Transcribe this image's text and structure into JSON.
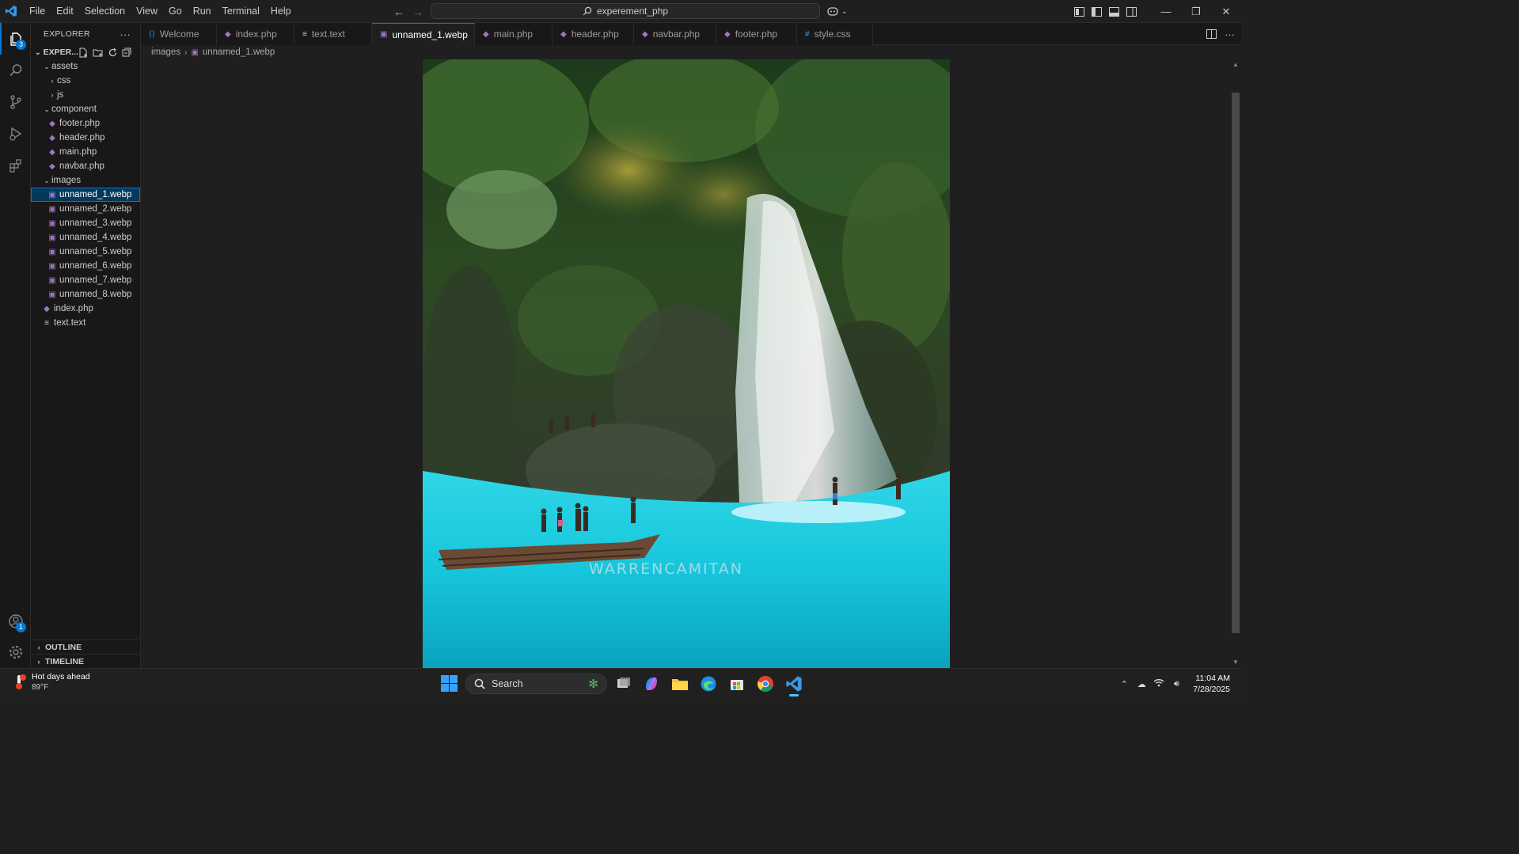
{
  "titlebar": {
    "menu": [
      "File",
      "Edit",
      "Selection",
      "View",
      "Go",
      "Run",
      "Terminal",
      "Help"
    ],
    "search_text": "experement_php"
  },
  "activity": {
    "explorer_badge": "3",
    "accounts_badge": "1"
  },
  "sidebar": {
    "title": "EXPLORER",
    "root_label": "EXPER...",
    "tree": [
      {
        "label": "assets",
        "kind": "folder-open",
        "depth": 1
      },
      {
        "label": "css",
        "kind": "folder",
        "depth": 2
      },
      {
        "label": "js",
        "kind": "folder",
        "depth": 2
      },
      {
        "label": "component",
        "kind": "folder-open",
        "depth": 1
      },
      {
        "label": "footer.php",
        "kind": "php",
        "depth": 2
      },
      {
        "label": "header.php",
        "kind": "php",
        "depth": 2
      },
      {
        "label": "main.php",
        "kind": "php",
        "depth": 2
      },
      {
        "label": "navbar.php",
        "kind": "php",
        "depth": 2
      },
      {
        "label": "images",
        "kind": "folder-open",
        "depth": 1
      },
      {
        "label": "unnamed_1.webp",
        "kind": "image",
        "depth": 2,
        "selected": true
      },
      {
        "label": "unnamed_2.webp",
        "kind": "image",
        "depth": 2
      },
      {
        "label": "unnamed_3.webp",
        "kind": "image",
        "depth": 2
      },
      {
        "label": "unnamed_4.webp",
        "kind": "image",
        "depth": 2
      },
      {
        "label": "unnamed_5.webp",
        "kind": "image",
        "depth": 2
      },
      {
        "label": "unnamed_6.webp",
        "kind": "image",
        "depth": 2
      },
      {
        "label": "unnamed_7.webp",
        "kind": "image",
        "depth": 2
      },
      {
        "label": "unnamed_8.webp",
        "kind": "image",
        "depth": 2
      },
      {
        "label": "index.php",
        "kind": "php",
        "depth": 1
      },
      {
        "label": "text.text",
        "kind": "text",
        "depth": 1
      }
    ],
    "outline_label": "OUTLINE",
    "timeline_label": "TIMELINE"
  },
  "tabs": [
    {
      "label": "Welcome",
      "icon": "vscode-icon",
      "state": "normal"
    },
    {
      "label": "index.php",
      "icon": "php-icon",
      "state": "normal"
    },
    {
      "label": "text.text",
      "icon": "text-file-icon",
      "state": "normal"
    },
    {
      "label": "unnamed_1.webp",
      "icon": "image-file-icon",
      "state": "active"
    },
    {
      "label": "main.php",
      "icon": "php-icon",
      "state": "modified"
    },
    {
      "label": "header.php",
      "icon": "php-icon",
      "state": "modified"
    },
    {
      "label": "navbar.php",
      "icon": "php-icon",
      "state": "normal"
    },
    {
      "label": "footer.php",
      "icon": "php-icon",
      "state": "modified"
    },
    {
      "label": "style.css",
      "icon": "css-icon",
      "state": "normal"
    }
  ],
  "breadcrumb": {
    "folder": "images",
    "file": "unnamed_1.webp"
  },
  "image": {
    "watermark": "WARRENCAMITAN"
  },
  "taskbar": {
    "weather_title": "Hot days ahead",
    "weather_temp": "89°F",
    "search_label": "Search",
    "time": "11:04 AM",
    "date": "7/28/2025"
  },
  "colors": {
    "accent": "#0078d4",
    "php": "#a074c4",
    "background": "#1f1f1f",
    "water": "#17c6dc"
  }
}
